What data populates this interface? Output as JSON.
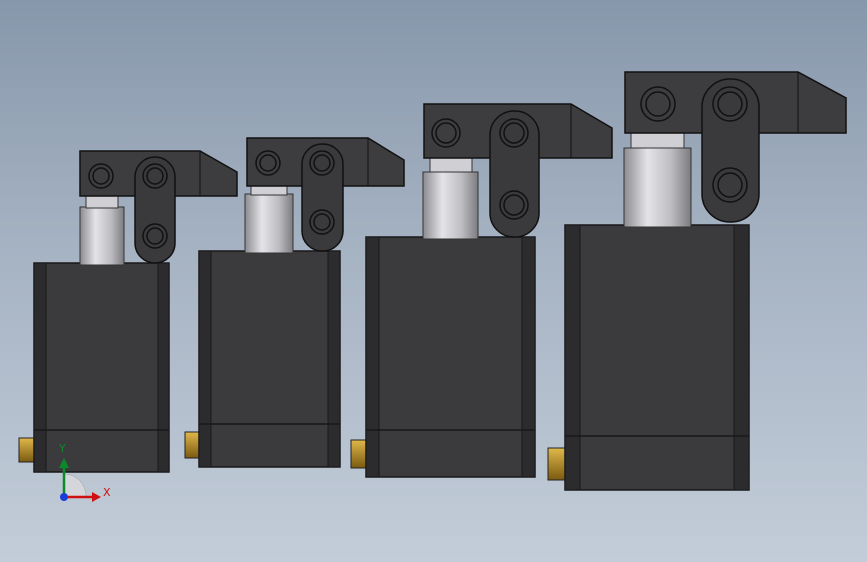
{
  "viewport": {
    "background_top": "#8797ab",
    "background_bottom": "#c3cdd9"
  },
  "model": {
    "part_count": 4,
    "colors": {
      "body": "#3b3b3d",
      "body_dark": "#28282a",
      "clamp": "#3d3d40",
      "rod": "#c4c4c8",
      "fitting": "#b8860b"
    }
  },
  "triad": {
    "x_label": "X",
    "y_label": "Y",
    "icons": [
      "x-axis-arrow-icon",
      "y-axis-arrow-icon",
      "z-axis-origin-icon"
    ]
  }
}
